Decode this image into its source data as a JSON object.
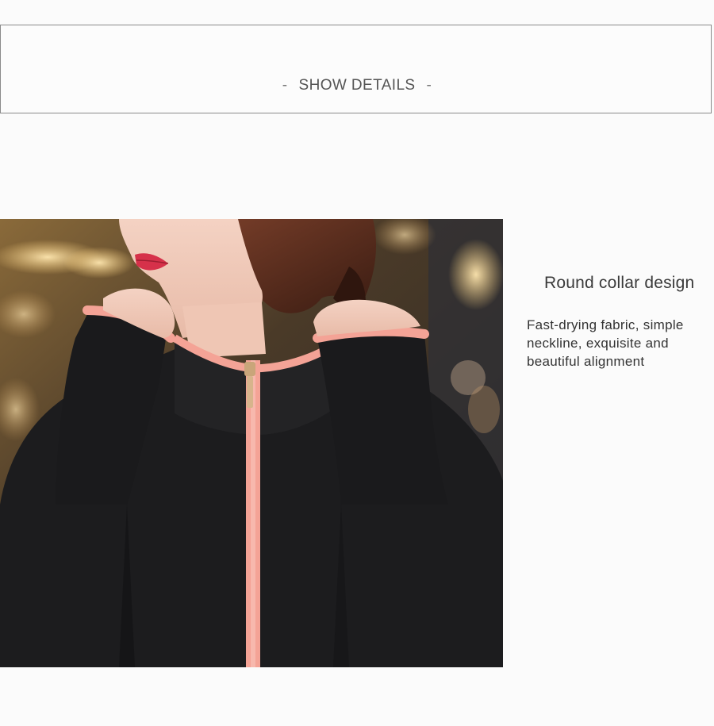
{
  "header": {
    "dash_left": "-",
    "title": "SHOW DETAILS",
    "dash_right": "-"
  },
  "feature": {
    "title": "Round collar design",
    "description": "Fast-drying fabric, simple neckline, exquisite and beautiful alignment"
  },
  "colors": {
    "jacket": "#1c1c1e",
    "trim": "#f4a396",
    "page_background": "#fbfbfb"
  }
}
